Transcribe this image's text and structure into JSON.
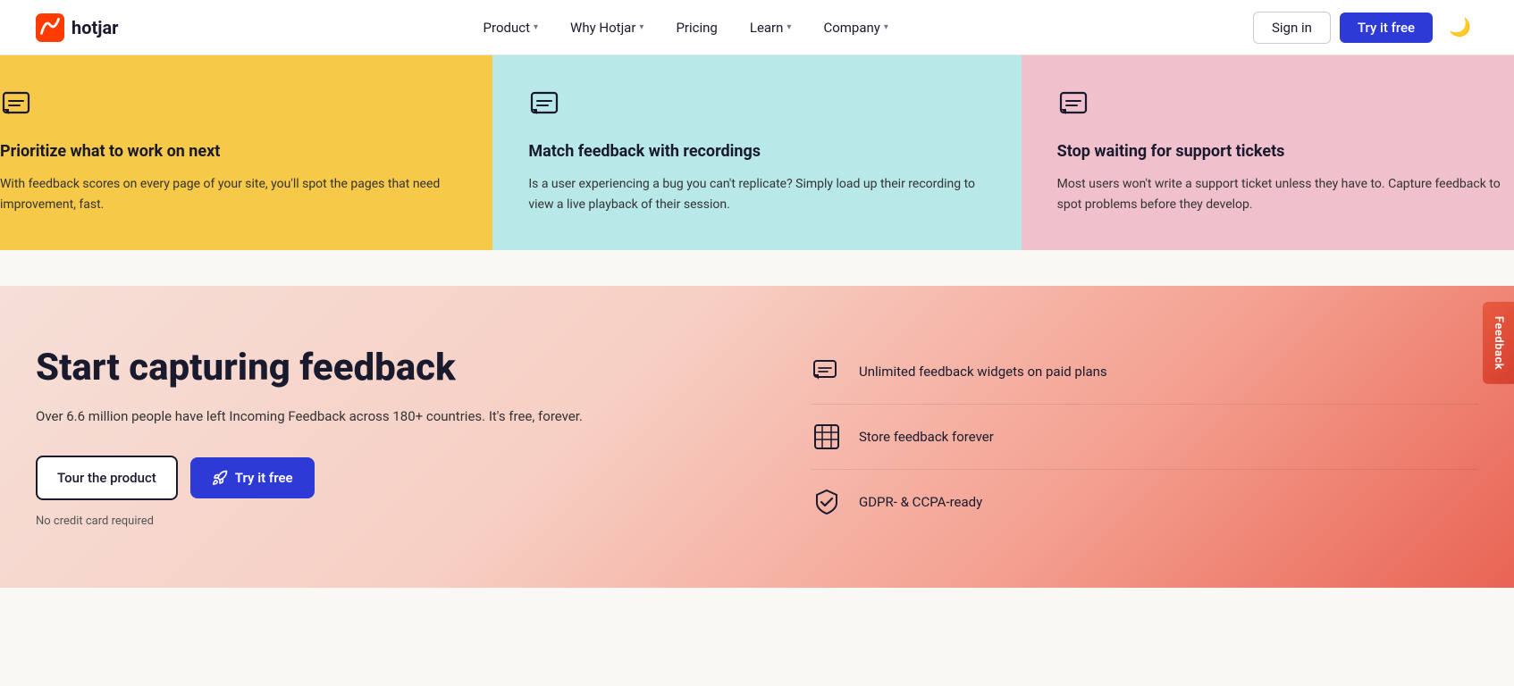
{
  "nav": {
    "logo_text": "hotjar",
    "links": [
      {
        "label": "Product",
        "has_dropdown": true
      },
      {
        "label": "Why Hotjar",
        "has_dropdown": true
      },
      {
        "label": "Pricing",
        "has_dropdown": false
      },
      {
        "label": "Learn",
        "has_dropdown": true
      },
      {
        "label": "Company",
        "has_dropdown": true
      }
    ],
    "signin_label": "Sign in",
    "try_label": "Try it free"
  },
  "cards": [
    {
      "title": "Prioritize what to work on next",
      "desc": "With feedback scores on every page of your site, you'll spot the pages that need improvement, fast.",
      "bg": "yellow"
    },
    {
      "title": "Match feedback with recordings",
      "desc": "Is a user experiencing a bug you can't replicate? Simply load up their recording to view a live playback of their session.",
      "bg": "teal"
    },
    {
      "title": "Stop waiting for support tickets",
      "desc": "Most users won't write a support ticket unless they have to. Capture feedback to spot problems before they develop.",
      "bg": "pink"
    }
  ],
  "cta": {
    "title": "Start capturing feedback",
    "desc": "Over 6.6 million people have left Incoming Feedback across 180+ countries. It's free, forever.",
    "tour_label": "Tour the product",
    "try_label": "Try it free",
    "no_cc": "No credit card required",
    "features": [
      {
        "text": "Unlimited feedback widgets on paid plans"
      },
      {
        "text": "Store feedback forever"
      },
      {
        "text": "GDPR- & CCPA-ready"
      }
    ]
  },
  "feedback_tab": {
    "label": "Feedback"
  }
}
